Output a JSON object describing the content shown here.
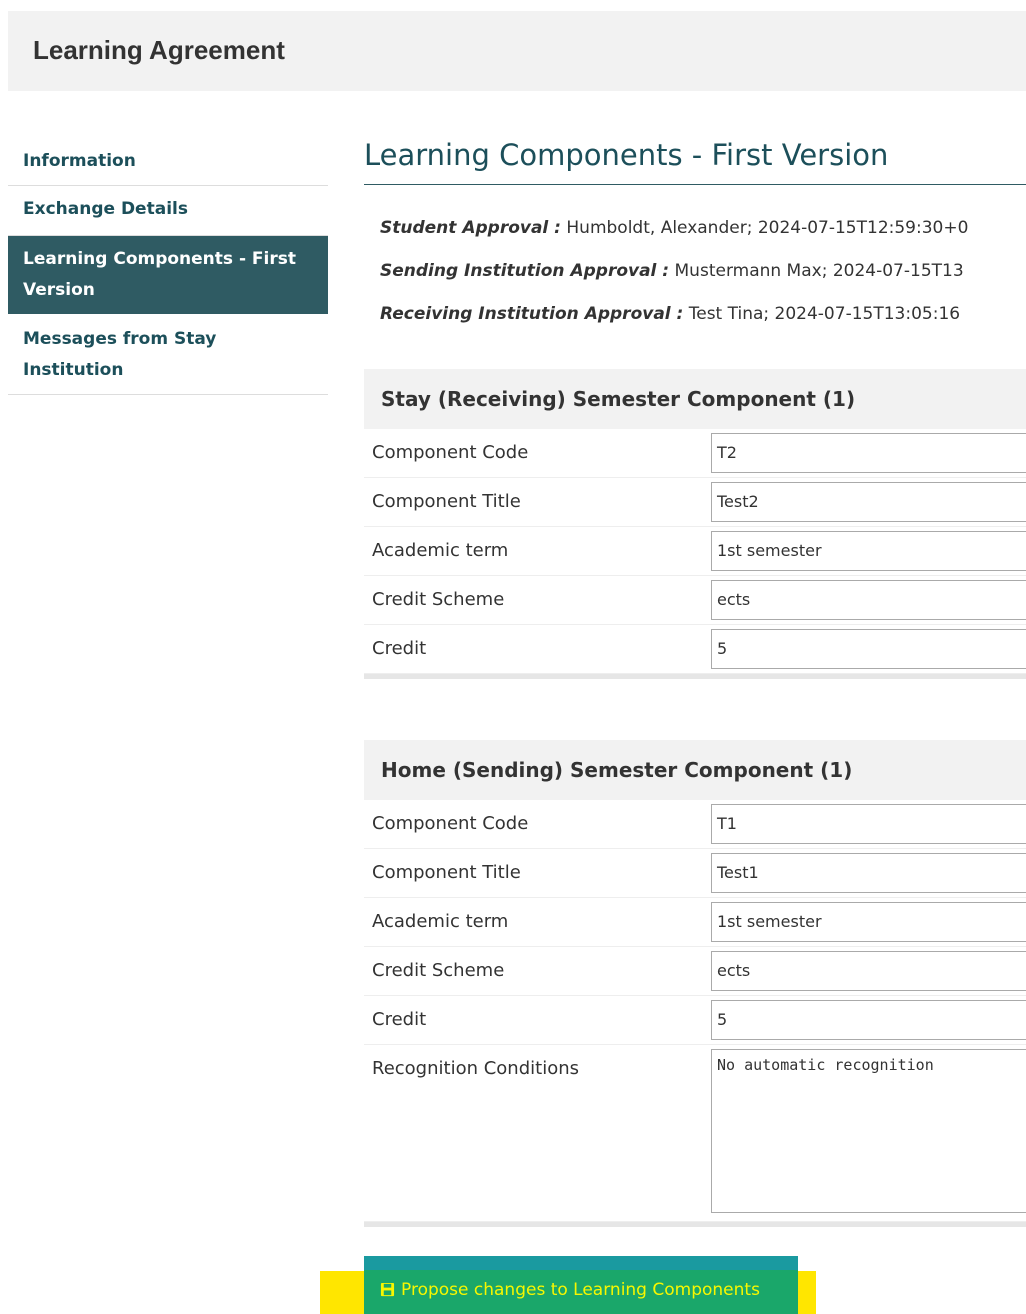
{
  "header": {
    "title": "Learning Agreement"
  },
  "sidebar": {
    "items": [
      {
        "label": "Information"
      },
      {
        "label": "Exchange Details"
      },
      {
        "label": "Learning Components - First Version"
      },
      {
        "label": "Messages from Stay Institution"
      }
    ],
    "active_index": 2
  },
  "main": {
    "title": "Learning Components - First Version",
    "approvals": [
      {
        "label": "Student Approval :",
        "value": "Humboldt, Alexander; 2024-07-15T12:59:30+0"
      },
      {
        "label": "Sending Institution Approval :",
        "value": "Mustermann Max; 2024-07-15T13"
      },
      {
        "label": "Receiving Institution Approval :",
        "value": "Test Tina; 2024-07-15T13:05:16"
      }
    ],
    "stay_component": {
      "heading": "Stay (Receiving) Semester Component (1)",
      "rows": [
        {
          "label": "Component Code",
          "value": "T2"
        },
        {
          "label": "Component Title",
          "value": "Test2"
        },
        {
          "label": "Academic term",
          "value": "1st semester"
        },
        {
          "label": "Credit Scheme",
          "value": "ects"
        },
        {
          "label": "Credit",
          "value": "5"
        }
      ]
    },
    "home_component": {
      "heading": "Home (Sending) Semester Component (1)",
      "rows": [
        {
          "label": "Component Code",
          "value": "T1"
        },
        {
          "label": "Component Title",
          "value": "Test1"
        },
        {
          "label": "Academic term",
          "value": "1st semester"
        },
        {
          "label": "Credit Scheme",
          "value": "ects"
        },
        {
          "label": "Credit",
          "value": "5"
        },
        {
          "label": "Recognition Conditions",
          "value": "No automatic recognition"
        }
      ]
    },
    "propose_button": {
      "label": "Propose changes to Learning Components",
      "icon": "save-icon"
    }
  },
  "colors": {
    "nav_active_bg": "#2f5b63",
    "nav_text": "#1c4f5a",
    "button_bg": "#1aa76a",
    "highlight": "#ffe600"
  }
}
